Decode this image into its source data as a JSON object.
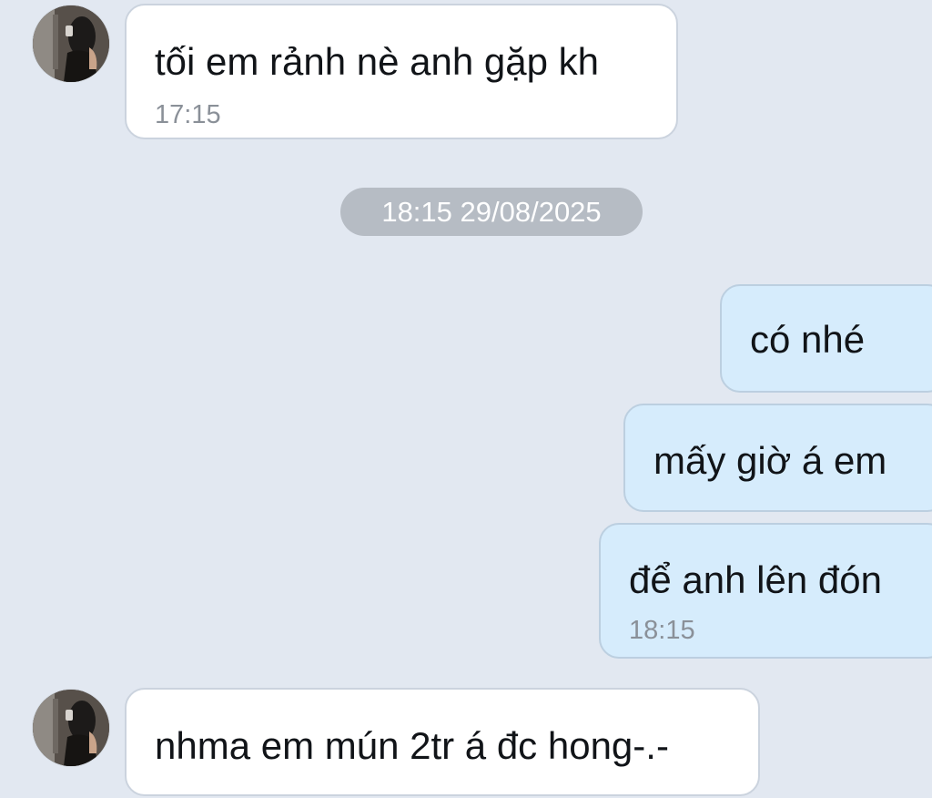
{
  "conversation": {
    "date_separator": "18:15 29/08/2025",
    "messages": [
      {
        "direction": "incoming",
        "text": "tối em rảnh nè anh gặp kh",
        "time": "17:15"
      },
      {
        "direction": "outgoing",
        "text": "có nhé",
        "time": ""
      },
      {
        "direction": "outgoing",
        "text": "mấy giờ á em",
        "time": ""
      },
      {
        "direction": "outgoing",
        "text": "để anh lên đón",
        "time": "18:15"
      },
      {
        "direction": "incoming",
        "text": "nhma em mún 2tr á đc hong-.-",
        "time": ""
      }
    ]
  },
  "colors": {
    "background": "#e2e8f1",
    "incoming_bubble": "#ffffff",
    "outgoing_bubble": "#d6ecfc",
    "date_pill": "#b6bcc4",
    "timestamp_text": "#8a9098"
  },
  "icons": {
    "avatar": "contact-profile-photo"
  }
}
